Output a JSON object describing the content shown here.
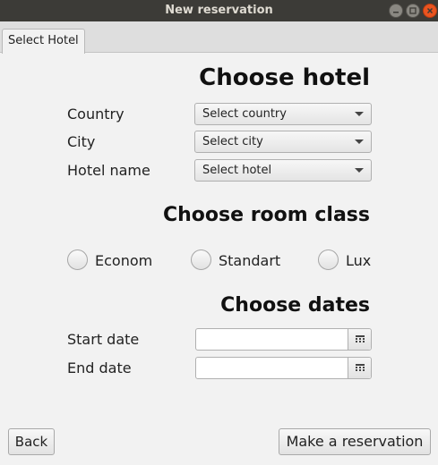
{
  "window": {
    "title": "New reservation"
  },
  "tabs": [
    {
      "label": "Select Hotel"
    }
  ],
  "hotel_section": {
    "heading": "Choose hotel",
    "country": {
      "label": "Country",
      "value": "Select country"
    },
    "city": {
      "label": "City",
      "value": "Select city"
    },
    "hotel": {
      "label": "Hotel name",
      "value": "Select hotel"
    }
  },
  "room_section": {
    "heading": "Choose room class",
    "options": [
      {
        "label": "Econom"
      },
      {
        "label": "Standart"
      },
      {
        "label": "Lux"
      }
    ]
  },
  "dates_section": {
    "heading": "Choose dates",
    "start": {
      "label": "Start date",
      "value": ""
    },
    "end": {
      "label": "End date",
      "value": ""
    }
  },
  "actions": {
    "back": "Back",
    "make": "Make a reservation"
  },
  "colors": {
    "titlebar": "#3c3b37",
    "close_button": "#e95420",
    "background": "#f2f2f2"
  },
  "icons": {
    "minimize": "minimize-icon",
    "maximize": "maximize-icon",
    "close": "close-icon",
    "calendar": "calendar-icon",
    "dropdown": "chevron-down-icon"
  }
}
